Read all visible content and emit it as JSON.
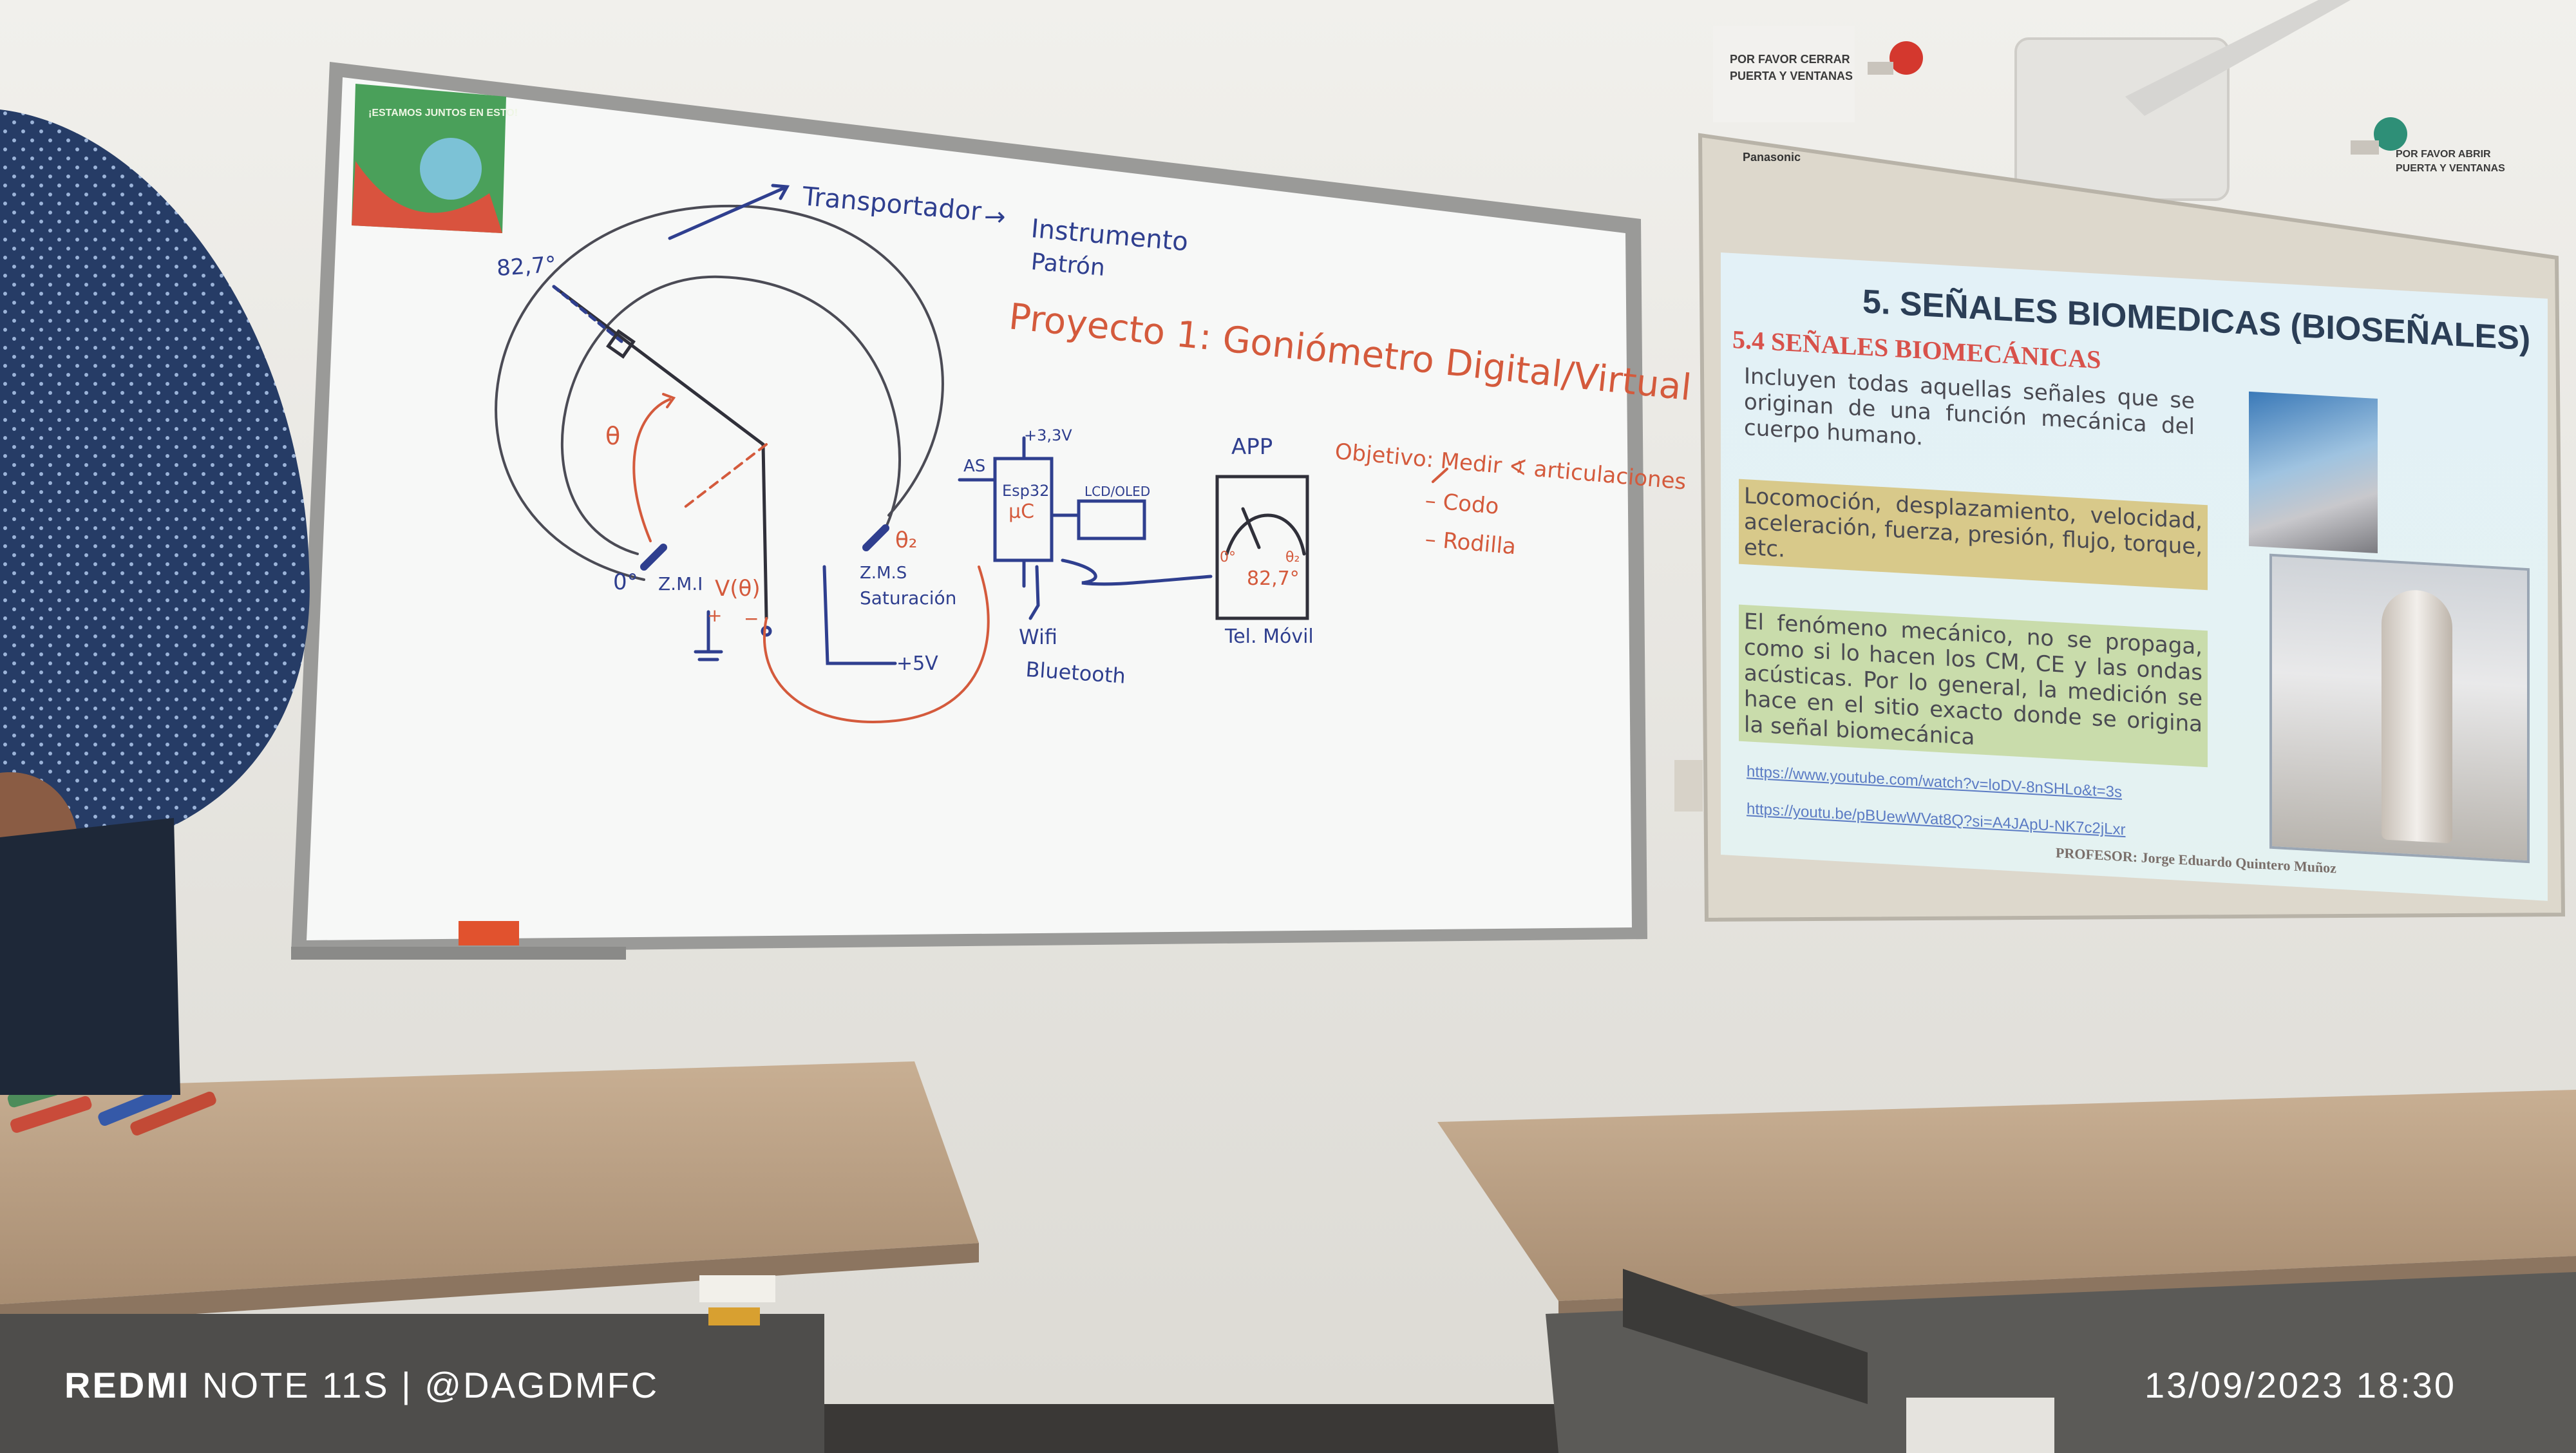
{
  "whiteboard": {
    "sticker_text": "¡ESTAMOS JUNTOS EN ESTO!",
    "angle_label": "82,7°",
    "transportador": "Transportador",
    "arrow": "→",
    "instrumento": "Instrumento",
    "patron": "Patrón",
    "proyecto": "Proyecto 1: Goniómetro Digital/Virtual",
    "theta": "θ",
    "theta2": "θ₂",
    "zero_deg": "0°",
    "zmi": "Z.M.I",
    "v_theta": "V(θ)",
    "plus": "+",
    "minus": "−",
    "zms": "Z.M.S",
    "saturacion": "Saturación",
    "plus5v": "+5V",
    "plus33v": "+3,3V",
    "as_label": "AS",
    "esp32": "Esp32",
    "uc": "µC",
    "lcd": "LCD/OLED",
    "wifi": "Wifi",
    "bluetooth": "Bluetooth",
    "app": "APP",
    "dial_zero": "0°",
    "dial_theta2": "θ₂",
    "dial_value": "82,7°",
    "tel_movil": "Tel. Móvil",
    "objetivo": "Objetivo: Medir ∢ articulaciones",
    "codo": "– Codo",
    "rodilla": "– Rodilla"
  },
  "wall_signs": {
    "sign1": [
      "POR FAVOR CERRAR",
      "PUERTA Y VENTANAS"
    ],
    "sign2": [
      "POR FAVOR ABRIR",
      "PUERTA Y VENTANAS"
    ]
  },
  "projector": {
    "brand": "Panasonic"
  },
  "slide": {
    "title": "5. SEÑALES BIOMEDICAS (BIOSEÑALES)",
    "subtitle": "5.4 SEÑALES BIOMECÁNICAS",
    "paragraph1": "Incluyen todas aquellas señales que se originan de una función mecánica del cuerpo humano.",
    "paragraph2": "Locomoción, desplazamiento, velocidad, aceleración, fuerza, presión, flujo, torque, etc.",
    "paragraph3": "El fenómeno mecánico, no se propaga, como si lo hacen los CM, CE y las ondas acústicas. Por lo general, la medición se hace en el sitio exacto donde se origina la señal biomecánica",
    "link1": "https://www.youtube.com/watch?v=loDV-8nSHLo&t=3s",
    "link2": "https://youtu.be/pBUewWVat8Q?si=A4JApU-NK7c2jLxr",
    "footer": "PROFESOR: Jorge Eduardo Quintero Muñoz"
  },
  "camera_watermark": {
    "brand": "REDMI",
    "model": "NOTE 11S | @DAGDMFC",
    "datetime": "13/09/2023  18:30"
  },
  "colors": {
    "wall": "#e9e7e2",
    "marker_blue": "#2f3f8f",
    "marker_red": "#d45a3c",
    "desk_top": "#b99f84",
    "slide_accent": "#d8524b"
  }
}
